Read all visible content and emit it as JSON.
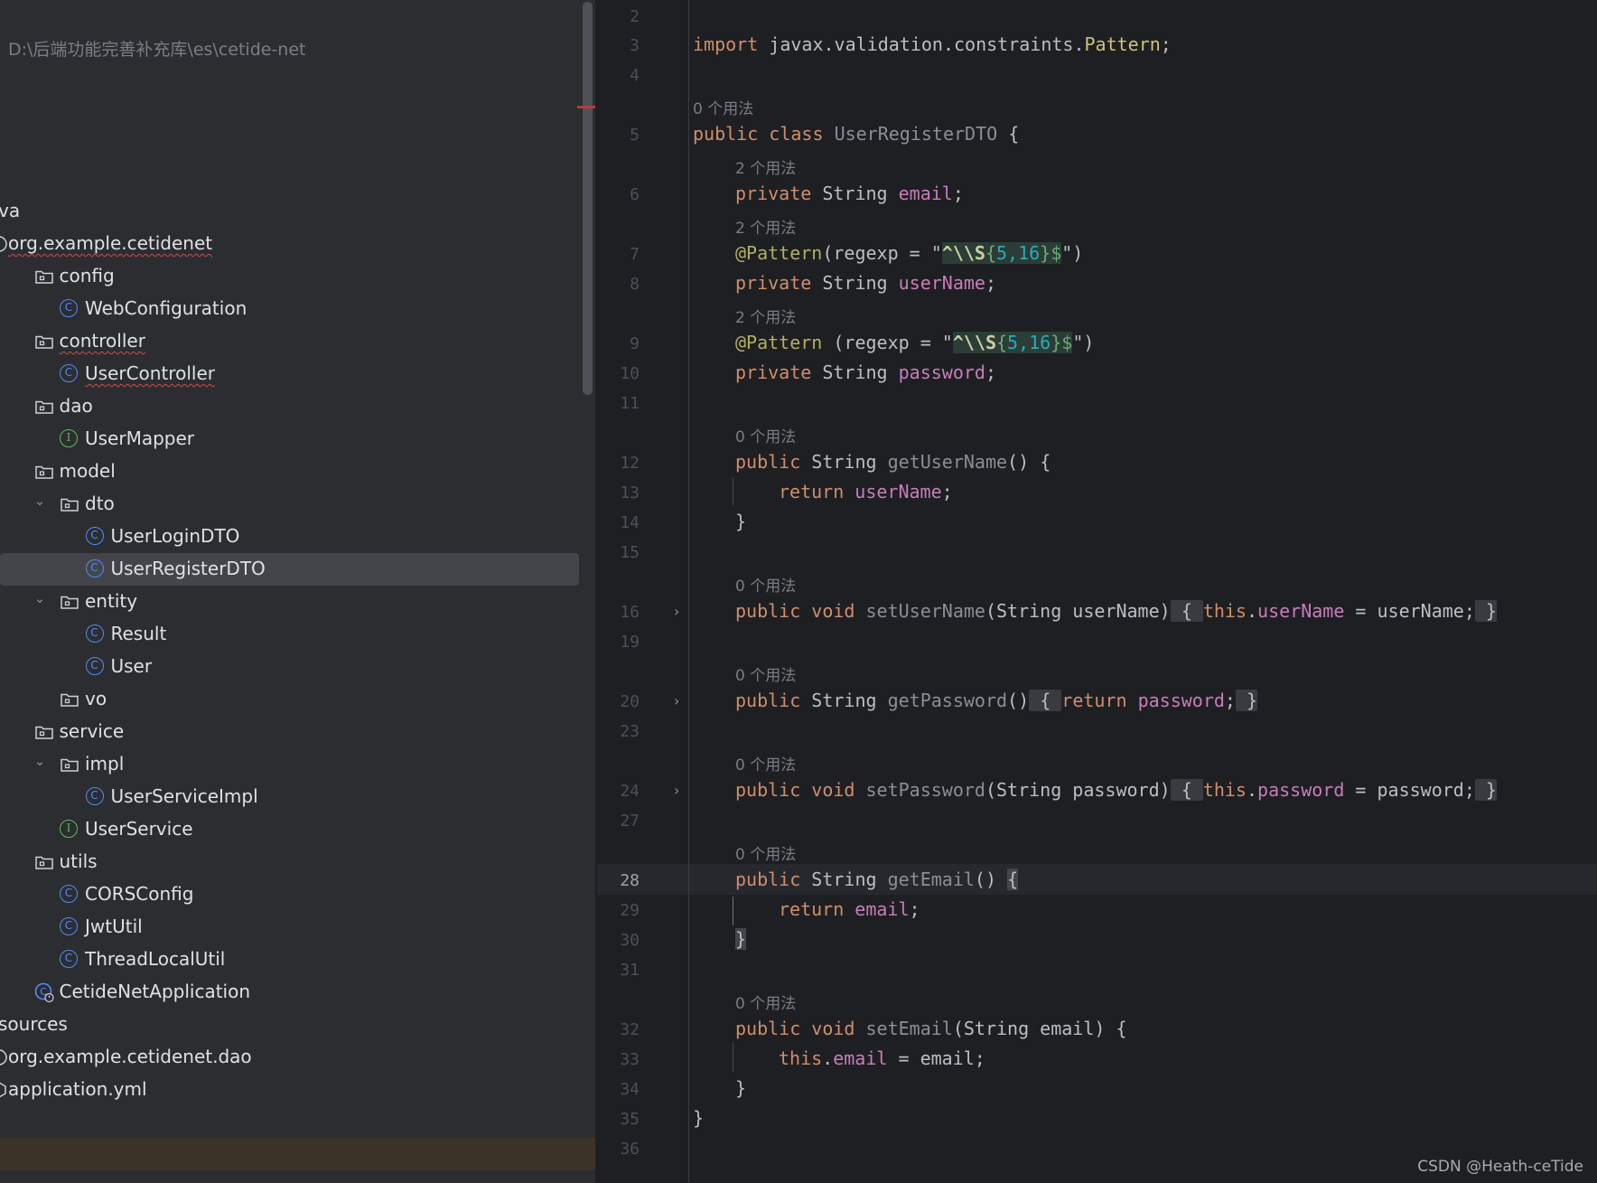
{
  "project_tree": {
    "path": "D:\\后端功能完善补充库\\es\\cetide-net",
    "items": [
      {
        "label": "va",
        "icon": "none",
        "wavy": false
      },
      {
        "label": "org.example.cetidenet",
        "icon": "package-icon",
        "wavy": true
      },
      {
        "label": "config",
        "icon": "folder-icon",
        "wavy": false
      },
      {
        "label": "WebConfiguration",
        "icon": "class-icon",
        "wavy": false
      },
      {
        "label": "controller",
        "icon": "folder-icon",
        "wavy": true
      },
      {
        "label": "UserController",
        "icon": "class-icon",
        "wavy": true
      },
      {
        "label": "dao",
        "icon": "folder-icon",
        "wavy": false
      },
      {
        "label": "UserMapper",
        "icon": "interface-icon",
        "wavy": false
      },
      {
        "label": "model",
        "icon": "folder-icon",
        "wavy": false
      },
      {
        "label": "dto",
        "icon": "folder-icon",
        "wavy": false
      },
      {
        "label": "UserLoginDTO",
        "icon": "class-icon",
        "wavy": false
      },
      {
        "label": "UserRegisterDTO",
        "icon": "class-icon",
        "wavy": false
      },
      {
        "label": "entity",
        "icon": "folder-icon",
        "wavy": false
      },
      {
        "label": "Result",
        "icon": "class-icon",
        "wavy": false
      },
      {
        "label": "User",
        "icon": "class-icon",
        "wavy": false
      },
      {
        "label": "vo",
        "icon": "folder-icon",
        "wavy": false
      },
      {
        "label": "service",
        "icon": "folder-icon",
        "wavy": false
      },
      {
        "label": "impl",
        "icon": "folder-icon",
        "wavy": false
      },
      {
        "label": "UserServiceImpl",
        "icon": "class-icon",
        "wavy": false
      },
      {
        "label": "UserService",
        "icon": "interface-icon",
        "wavy": false
      },
      {
        "label": "utils",
        "icon": "folder-icon",
        "wavy": false
      },
      {
        "label": "CORSConfig",
        "icon": "class-icon",
        "wavy": false
      },
      {
        "label": "JwtUtil",
        "icon": "class-icon",
        "wavy": false
      },
      {
        "label": "ThreadLocalUtil",
        "icon": "class-icon",
        "wavy": false
      },
      {
        "label": "CetideNetApplication",
        "icon": "spring-boot-class-icon",
        "wavy": false
      },
      {
        "label": "sources",
        "icon": "none",
        "wavy": false
      },
      {
        "label": "org.example.cetidenet.dao",
        "icon": "package-icon",
        "wavy": false
      },
      {
        "label": "application.yml",
        "icon": "yaml-icon",
        "wavy": false
      }
    ],
    "selected": "UserRegisterDTO"
  },
  "editor": {
    "usage_hints": {
      "zero": "0 个用法",
      "two": "2 个用法"
    },
    "line_numbers": [
      "2",
      "3",
      "4",
      "5",
      "6",
      "7",
      "8",
      "9",
      "10",
      "11",
      "12",
      "13",
      "14",
      "15",
      "16",
      "19",
      "20",
      "23",
      "24",
      "27",
      "28",
      "29",
      "30",
      "31",
      "32",
      "33",
      "34",
      "35",
      "36"
    ],
    "current_line": "28",
    "tokens": {
      "import": "import",
      "import_path": "javax.validation.constraints.",
      "pattern": "Pattern",
      "semi": ";",
      "public": "public",
      "class": "class",
      "private": "private",
      "void": "void",
      "return": "return",
      "this": "this",
      "class_name": "UserRegisterDTO",
      "string_type": "String",
      "email": "email",
      "userName": "userName",
      "password": "password",
      "annotation": "@Pattern",
      "regexp_open": "(regexp = \"",
      "regexp_open_sp": " (regexp = \"",
      "regex_anchor": "^\\\\S",
      "regex_brace_open": "{",
      "regex_nums": "5,16",
      "regex_brace_close": "}$",
      "regexp_close": "\")",
      "getUserName": "getUserName",
      "setUserName": "setUserName",
      "getPassword": "getPassword",
      "setPassword": "setPassword",
      "getEmail": "getEmail",
      "setEmail": "setEmail",
      "param_userName": "(String userName)",
      "param_password": "(String password)",
      "param_email": "(String email)",
      "empty_parens": "()",
      "open_brace": "{",
      "close_brace": "}"
    }
  },
  "watermark": "CSDN @Heath-ceTide"
}
